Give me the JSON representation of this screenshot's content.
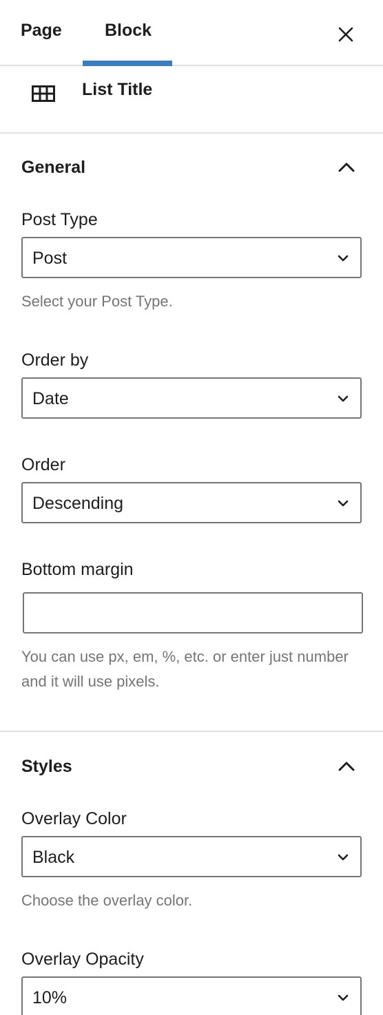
{
  "tabs": {
    "page_label": "Page",
    "block_label": "Block",
    "active": "Block"
  },
  "block_card": {
    "icon": "grid-icon",
    "title": "List Title"
  },
  "general": {
    "title": "General",
    "post_type": {
      "label": "Post Type",
      "value": "Post",
      "help": "Select your Post Type."
    },
    "order_by": {
      "label": "Order by",
      "value": "Date"
    },
    "order": {
      "label": "Order",
      "value": "Descending"
    },
    "bottom_margin": {
      "label": "Bottom margin",
      "value": "",
      "help": "You can use px, em, %, etc. or enter just number and it will use pixels."
    }
  },
  "styles": {
    "title": "Styles",
    "overlay_color": {
      "label": "Overlay Color",
      "value": "Black",
      "help": "Choose the overlay color."
    },
    "overlay_opacity": {
      "label": "Overlay Opacity",
      "value": "10%"
    }
  },
  "colors": {
    "accent": "#3a7ec1",
    "help_text": "#757575",
    "border": "#757575",
    "divider": "#e0e0e0"
  }
}
